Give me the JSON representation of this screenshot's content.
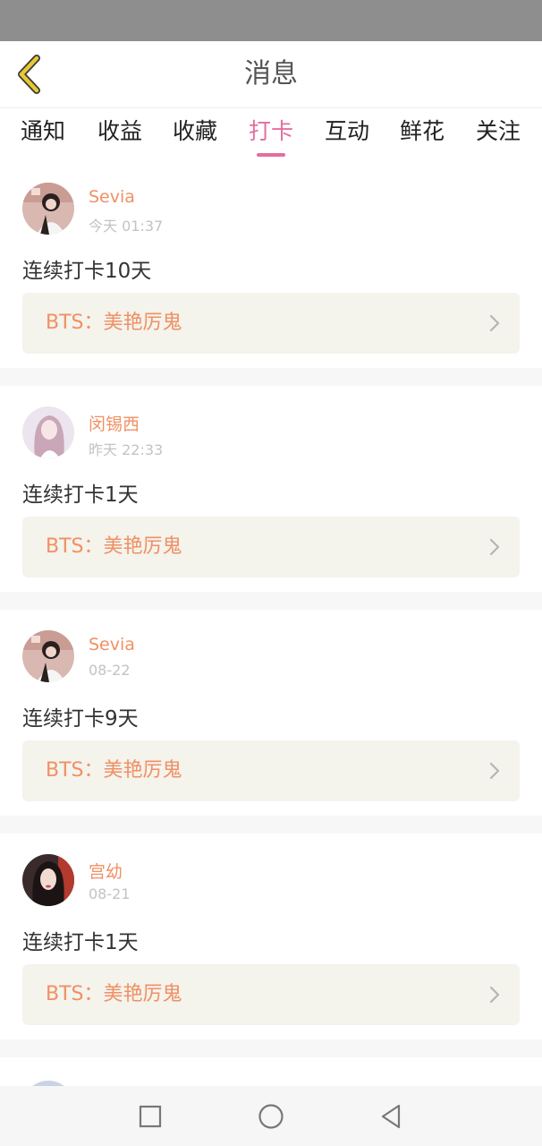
{
  "header": {
    "title": "消息"
  },
  "tabs": [
    {
      "label": "通知"
    },
    {
      "label": "收益"
    },
    {
      "label": "收藏"
    },
    {
      "label": "打卡",
      "active": true
    },
    {
      "label": "互动"
    },
    {
      "label": "鲜花"
    },
    {
      "label": "关注"
    }
  ],
  "feed": [
    {
      "username": "Sevia",
      "time": "今天 01:37",
      "content": "连续打卡10天",
      "book": "BTS：美艳厉鬼"
    },
    {
      "username": "闵锡西",
      "time": "昨天 22:33",
      "content": "连续打卡1天",
      "book": "BTS：美艳厉鬼"
    },
    {
      "username": "Sevia",
      "time": "08-22",
      "content": "连续打卡9天",
      "book": "BTS：美艳厉鬼"
    },
    {
      "username": "宫幼",
      "time": "08-21",
      "content": "连续打卡1天",
      "book": "BTS：美艳厉鬼"
    }
  ],
  "colors": {
    "accent": "#e36ea0",
    "username": "#f09064",
    "book_link_bg": "#f4f3ec",
    "back_arrow": "#e8c832",
    "status_bar": "#8e8e8e"
  },
  "icons": {
    "back": "chevron-left-icon",
    "link_arrow": "chevron-right-icon",
    "nav_recents": "square-icon",
    "nav_home": "circle-icon",
    "nav_back": "triangle-back-icon"
  }
}
